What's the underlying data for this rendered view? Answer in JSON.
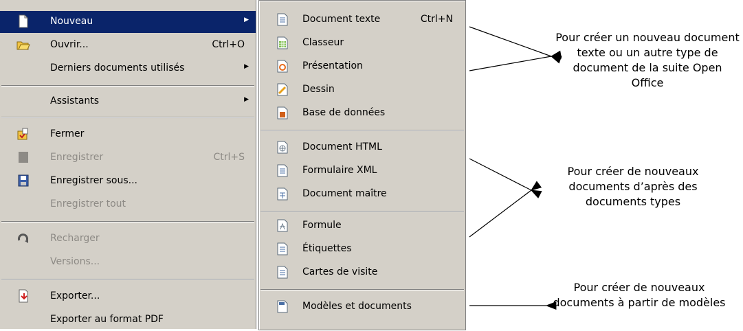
{
  "main_menu": {
    "items": [
      {
        "label": "Nouveau",
        "icon": "new-document-icon",
        "has_submenu": true,
        "selected": true
      },
      {
        "label": "Ouvrir...",
        "shortcut": "Ctrl+O",
        "icon": "open-folder-icon"
      },
      {
        "label": "Derniers documents utilisés",
        "has_submenu": true
      },
      {
        "label": "Assistants",
        "has_submenu": true
      },
      {
        "label": "Fermer",
        "icon": "close-document-icon"
      },
      {
        "label": "Enregistrer",
        "shortcut": "Ctrl+S",
        "icon": "save-disabled-icon",
        "disabled": true
      },
      {
        "label": "Enregistrer sous...",
        "icon": "save-as-icon"
      },
      {
        "label": "Enregistrer tout",
        "disabled": true
      },
      {
        "label": "Recharger",
        "icon": "reload-icon",
        "disabled": true
      },
      {
        "label": "Versions...",
        "disabled": true
      },
      {
        "label": "Exporter...",
        "icon": "export-icon"
      },
      {
        "label": "Exporter au format PDF"
      }
    ]
  },
  "submenu": {
    "items": [
      {
        "label": "Document texte",
        "shortcut": "Ctrl+N",
        "icon": "text-document-icon"
      },
      {
        "label": "Classeur",
        "icon": "spreadsheet-icon"
      },
      {
        "label": "Présentation",
        "icon": "presentation-icon"
      },
      {
        "label": "Dessin",
        "icon": "drawing-icon"
      },
      {
        "label": "Base de données",
        "icon": "database-icon"
      },
      {
        "label": "Document HTML",
        "icon": "html-document-icon"
      },
      {
        "label": "Formulaire XML",
        "icon": "xml-form-icon"
      },
      {
        "label": "Document maître",
        "icon": "master-document-icon"
      },
      {
        "label": "Formule",
        "icon": "formula-icon"
      },
      {
        "label": "Étiquettes",
        "icon": "labels-icon"
      },
      {
        "label": "Cartes de visite",
        "icon": "business-cards-icon"
      },
      {
        "label": "Modèles et documents",
        "icon": "templates-icon"
      }
    ]
  },
  "annotations": [
    {
      "text": "Pour créer un nouveau document texte ou un autre type de document de la suite Open Office"
    },
    {
      "text": "Pour créer de nouveaux documents d’après des documents types"
    },
    {
      "text": "Pour créer de nouveaux documents à partir de modèles"
    }
  ],
  "colors": {
    "menu_bg": "#d4d0c8",
    "selection": "#0a246a",
    "disabled_text": "#8d8a85"
  }
}
